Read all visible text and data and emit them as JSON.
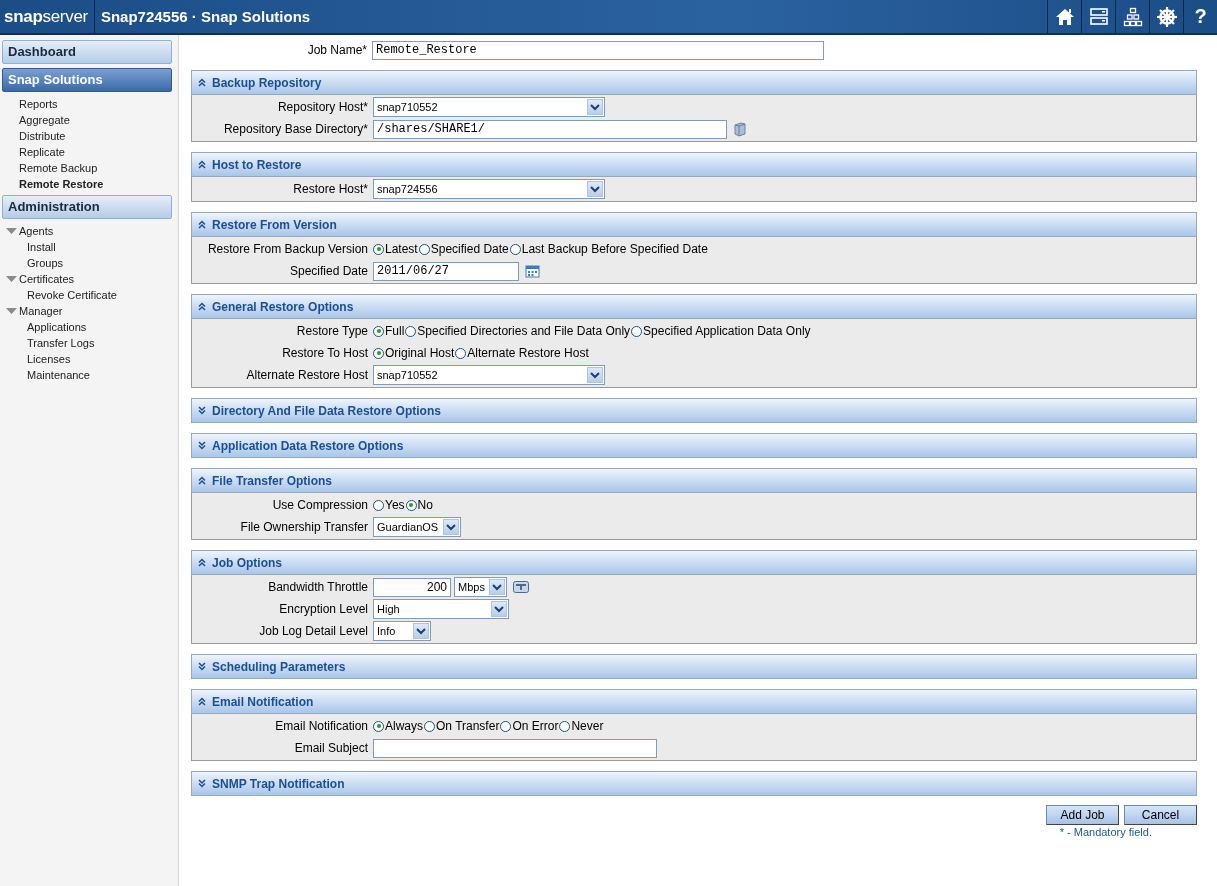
{
  "header": {
    "logo": "**snap**server",
    "title": "Snap724556 · Snap Solutions",
    "help": "?"
  },
  "sidebar": {
    "sections": [
      {
        "title": "Dashboard",
        "selected": false
      },
      {
        "title": "Snap Solutions",
        "selected": true,
        "items": [
          {
            "label": "Reports",
            "selected": false
          },
          {
            "label": "Aggregate",
            "selected": false
          },
          {
            "label": "Distribute",
            "selected": false
          },
          {
            "label": "Replicate",
            "selected": false
          },
          {
            "label": "Remote Backup",
            "selected": false
          },
          {
            "label": "Remote Restore",
            "selected": true
          }
        ]
      },
      {
        "title": "Administration",
        "selected": false,
        "items": [
          {
            "label": "Agents",
            "expanded": true,
            "children": [
              {
                "label": "Install",
                "selected": false
              },
              {
                "label": "Groups",
                "selected": false
              }
            ]
          },
          {
            "label": "Certificates",
            "expanded": true,
            "children": [
              {
                "label": "Revoke Certificate",
                "selected": false
              }
            ]
          },
          {
            "label": "Manager",
            "expanded": true,
            "children": [
              {
                "label": "Applications",
                "selected": false
              },
              {
                "label": "Transfer Logs",
                "selected": false
              },
              {
                "label": "Licenses",
                "selected": false
              },
              {
                "label": "Maintenance",
                "selected": false
              }
            ]
          }
        ]
      }
    ]
  },
  "job_name": {
    "label": "Job Name*",
    "value": "Remote_Restore"
  },
  "sections": [
    {
      "title": "Backup Repository",
      "expanded": true,
      "rows": [
        {
          "kind": "select",
          "label": "Repository Host*",
          "value": "snap710552"
        },
        {
          "kind": "browse",
          "label": "Repository Base Directory*",
          "value": "/shares/SHARE1/"
        }
      ]
    },
    {
      "title": "Host to Restore",
      "expanded": true,
      "rows": [
        {
          "kind": "select",
          "label": "Restore Host*",
          "value": "snap724556"
        }
      ]
    },
    {
      "title": "Restore From Version",
      "expanded": true,
      "rows": [
        {
          "kind": "radio",
          "label": "Restore From Backup Version",
          "options": [
            {
              "label": "Latest",
              "selected": true
            },
            {
              "label": "Specified Date",
              "selected": false
            },
            {
              "label": "Last Backup Before Specified Date",
              "selected": false
            }
          ]
        },
        {
          "kind": "date",
          "label": "Specified Date",
          "value": "2011/06/27"
        }
      ]
    },
    {
      "title": "General Restore Options",
      "expanded": true,
      "rows": [
        {
          "kind": "radio",
          "label": "Restore Type",
          "options": [
            {
              "label": "Full",
              "selected": true
            },
            {
              "label": "Specified Directories and File Data Only",
              "selected": false
            },
            {
              "label": "Specified Application Data Only",
              "selected": false
            }
          ]
        },
        {
          "kind": "radio",
          "label": "Restore To Host",
          "options": [
            {
              "label": "Original Host",
              "selected": true
            },
            {
              "label": "Alternate Restore Host",
              "selected": false
            }
          ]
        },
        {
          "kind": "select",
          "label": "Alternate Restore Host",
          "value": "snap710552"
        }
      ]
    },
    {
      "title": "Directory And File Data Restore Options",
      "expanded": false
    },
    {
      "title": "Application Data Restore Options",
      "expanded": false
    },
    {
      "title": "File Transfer Options",
      "expanded": true,
      "rows": [
        {
          "kind": "radio",
          "label": "Use Compression",
          "options": [
            {
              "label": "Yes",
              "selected": false
            },
            {
              "label": "No",
              "selected": true
            }
          ]
        },
        {
          "kind": "select",
          "label": "File Ownership Transfer",
          "value": "GuardianOS"
        }
      ]
    },
    {
      "title": "Job Options",
      "expanded": true,
      "rows": [
        {
          "kind": "throttle",
          "label": "Bandwidth Throttle",
          "value": "200",
          "unit": "Mbps"
        },
        {
          "kind": "select",
          "label": "Encryption Level",
          "value": "High"
        },
        {
          "kind": "select",
          "label": "Job Log Detail Level",
          "value": "Info"
        }
      ]
    },
    {
      "title": "Scheduling Parameters",
      "expanded": false
    },
    {
      "title": "Email Notification",
      "expanded": true,
      "rows": [
        {
          "kind": "radio",
          "label": "Email Notification",
          "options": [
            {
              "label": "Always",
              "selected": true
            },
            {
              "label": "On Transfer",
              "selected": false
            },
            {
              "label": "On Error",
              "selected": false
            },
            {
              "label": "Never",
              "selected": false
            }
          ]
        },
        {
          "kind": "text",
          "label": "Email Subject",
          "value": ""
        }
      ]
    },
    {
      "title": "SNMP Trap Notification",
      "expanded": false
    }
  ],
  "buttons": [
    "Add Job",
    "Cancel"
  ],
  "note": "* - Mandatory field."
}
